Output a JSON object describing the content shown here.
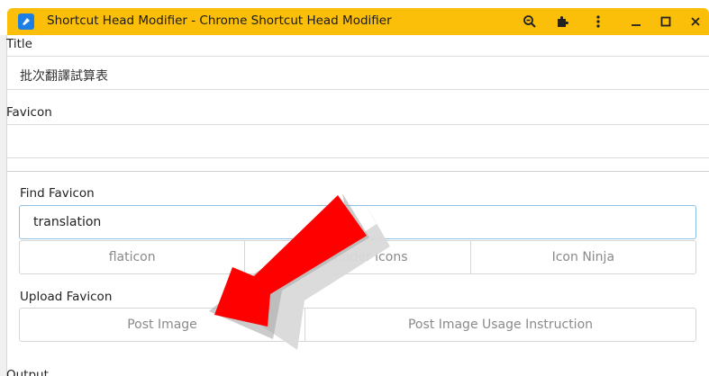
{
  "window": {
    "title": "Shortcut Head Modifier - Chrome Shortcut Head Modifier"
  },
  "titlebar_buttons": [
    "zoom-icon",
    "extensions-icon",
    "more-vert-icon",
    "minimize-icon",
    "maximize-icon",
    "close-icon"
  ],
  "colors": {
    "titlebar": "#fbbf0a",
    "arrow": "#ff0000",
    "input_focus_border": "#8ec0e4"
  },
  "form": {
    "title_label": "Title",
    "title_value": "批次翻譯試算表",
    "favicon_label": "Favicon",
    "favicon_value": "",
    "find_favicon_label": "Find Favicon",
    "search_value": "translation",
    "search_buttons": [
      "flaticon",
      "Iconfinder icons",
      "Icon Ninja"
    ],
    "upload_label": "Upload Favicon",
    "upload_buttons": [
      "Post Image",
      "Post Image Usage Instruction"
    ],
    "output_label": "Output"
  }
}
